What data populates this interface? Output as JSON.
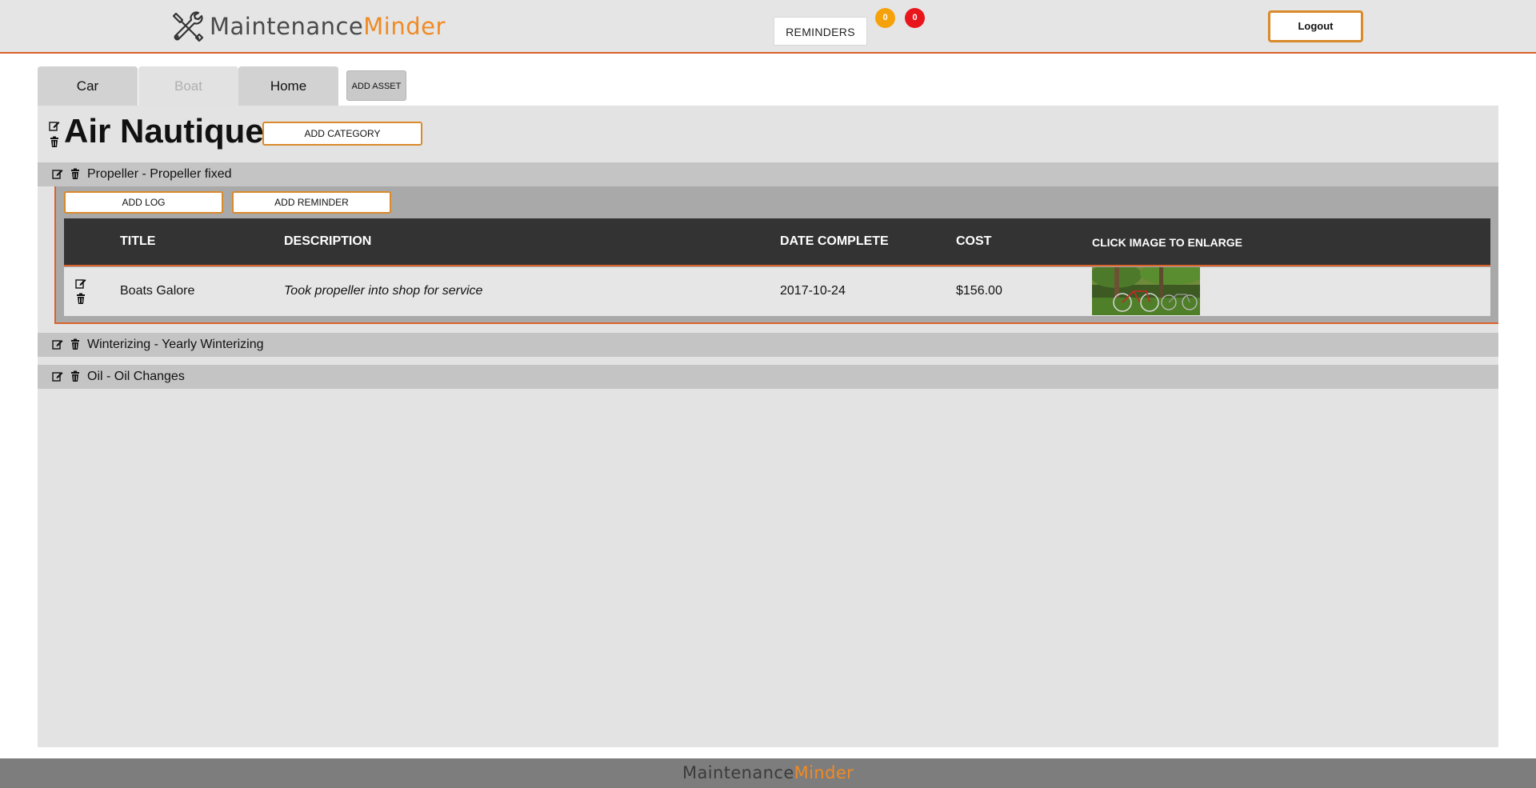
{
  "brand": {
    "name_part1": "Maintenance",
    "name_part2": "Minder"
  },
  "header": {
    "reminders_label": "REMINDERS",
    "badge_orange": "0",
    "badge_red": "0",
    "logout_label": "Logout"
  },
  "tabs": [
    {
      "label": "Car"
    },
    {
      "label": "Boat"
    },
    {
      "label": "Home"
    }
  ],
  "add_asset_label": "ADD ASSET",
  "asset": {
    "title": "Air Nautique",
    "add_category_label": "ADD CATEGORY"
  },
  "categories": [
    {
      "label": "Propeller - Propeller fixed"
    },
    {
      "label": "Winterizing - Yearly Winterizing"
    },
    {
      "label": "Oil - Oil Changes"
    }
  ],
  "category_actions": {
    "add_log_label": "ADD LOG",
    "add_reminder_label": "ADD REMINDER"
  },
  "table": {
    "headers": [
      "TITLE",
      "DESCRIPTION",
      "DATE COMPLETE",
      "COST",
      "CLICK IMAGE TO ENLARGE"
    ],
    "rows": [
      {
        "title": "Boats Galore",
        "description": "Took propeller into shop for service",
        "date": "2017-10-24",
        "cost": "$156.00"
      }
    ]
  },
  "colors": {
    "accent": "#d9622b",
    "brand_orange": "#f08a24",
    "badge_orange": "#f5a20a",
    "badge_red": "#e8161c"
  },
  "icons": {
    "edit": "edit-icon",
    "delete": "trash-icon",
    "logo": "wrench-screwdriver-icon"
  }
}
